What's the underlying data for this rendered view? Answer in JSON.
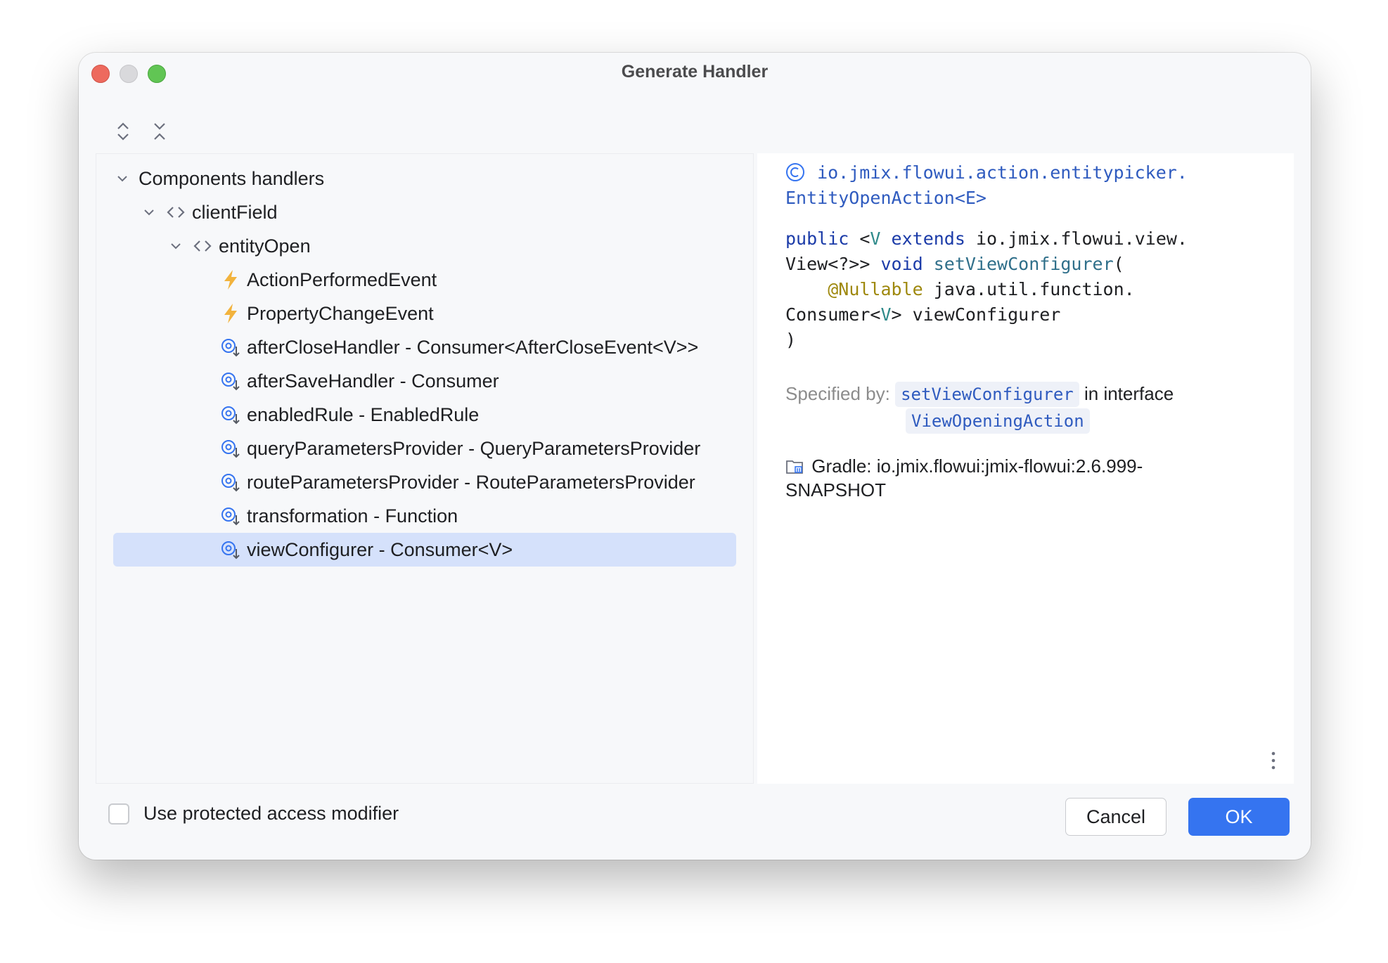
{
  "window": {
    "title": "Generate Handler"
  },
  "toolbar": {
    "expand_all_icon": "expand-all-icon",
    "collapse_all_icon": "collapse-all-icon"
  },
  "tree": {
    "root": {
      "label": "Components handlers"
    },
    "component": {
      "label": "clientField",
      "icon": "code-brackets-icon"
    },
    "action": {
      "label": "entityOpen",
      "icon": "code-brackets-icon"
    },
    "events": [
      {
        "label": "ActionPerformedEvent",
        "icon": "lightning-icon"
      },
      {
        "label": "PropertyChangeEvent",
        "icon": "lightning-icon"
      }
    ],
    "handlers": [
      {
        "label": "afterCloseHandler - Consumer<AfterCloseEvent<V>>",
        "icon": "handler-icon"
      },
      {
        "label": "afterSaveHandler - Consumer",
        "icon": "handler-icon"
      },
      {
        "label": "enabledRule - EnabledRule",
        "icon": "handler-icon"
      },
      {
        "label": "queryParametersProvider - QueryParametersProvider",
        "icon": "handler-icon"
      },
      {
        "label": "routeParametersProvider - RouteParametersProvider",
        "icon": "handler-icon"
      },
      {
        "label": "transformation - Function",
        "icon": "handler-icon"
      },
      {
        "label": "viewConfigurer - Consumer<V>",
        "icon": "handler-icon",
        "selected": true
      }
    ]
  },
  "doc": {
    "class_line1": "io.jmix.flowui.action.entitypicker.",
    "class_line2": "EntityOpenAction<E>",
    "sig": {
      "public": "public",
      "lt": " <",
      "V": "V",
      "extends": "extends",
      "pkg": " io.jmix.flowui.view.",
      "view_q": "View<?>> ",
      "void": "void",
      "method": "setViewConfigurer",
      "paren_open": "(",
      "nullable": "@Nullable",
      "java_util": " java.util.function.",
      "consumer": "Consumer<",
      "V2": "V",
      "param": "> viewConfigurer",
      "paren_close": ")"
    },
    "specified_by_label": "Specified by:",
    "specified_method": "setViewConfigurer",
    "in_interface": "in interface",
    "interface_name": "ViewOpeningAction",
    "gradle": "Gradle: io.jmix.flowui:jmix-flowui:2.6.999-SNAPSHOT"
  },
  "footer": {
    "checkbox_label": "Use protected access modifier",
    "checkbox_checked": false,
    "cancel_label": "Cancel",
    "ok_label": "OK"
  },
  "colors": {
    "accent": "#3574f0",
    "selection": "#d5e1fb",
    "link": "#2f5bbf",
    "lightning": "#f2b33d"
  }
}
